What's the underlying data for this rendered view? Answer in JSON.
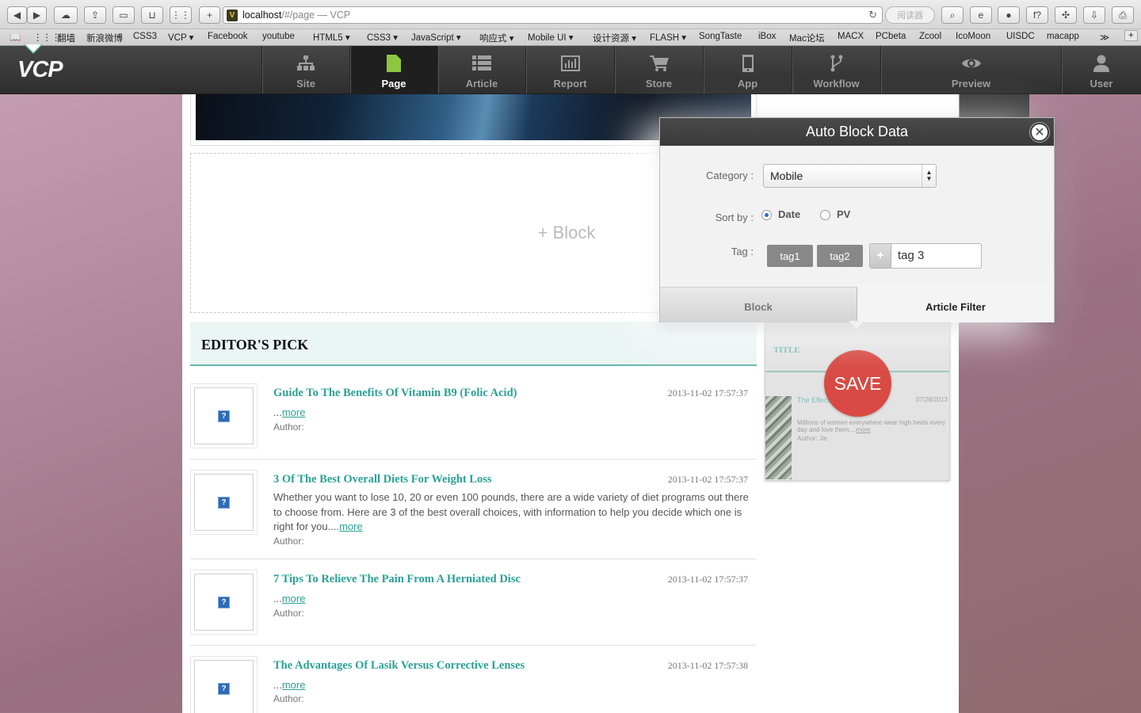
{
  "browser": {
    "url_host": "localhost",
    "url_rest": "/#/page — VCP",
    "reader_label": "阅读器"
  },
  "bookmarks": [
    "翻墙",
    "新浪微博",
    "CSS3",
    "VCP ▾",
    "Facebook",
    "youtube",
    "HTML5 ▾",
    "CSS3 ▾",
    "JavaScript ▾",
    "响应式 ▾",
    "Mobile UI ▾",
    "设计资源 ▾",
    "FLASH ▾",
    "SongTaste",
    "iBox",
    "Mac论坛",
    "MACX",
    "PCbeta",
    "Zcool",
    "IcoMoon",
    "UISDC",
    "macapp"
  ],
  "app": {
    "logo": "VCP",
    "nav": [
      {
        "label": "Site",
        "icon": "sitemap-icon"
      },
      {
        "label": "Page",
        "icon": "page-icon",
        "active": true
      },
      {
        "label": "Article",
        "icon": "list-icon"
      },
      {
        "label": "Report",
        "icon": "chart-icon"
      },
      {
        "label": "Store",
        "icon": "cart-icon"
      },
      {
        "label": "App",
        "icon": "phone-icon"
      },
      {
        "label": "Workflow",
        "icon": "branch-icon"
      },
      {
        "label": "Preview",
        "icon": "eye-icon"
      },
      {
        "label": "User",
        "icon": "user-icon"
      }
    ],
    "accent_color": "#8cc63f"
  },
  "page": {
    "add_block_label": "+ Block",
    "section_title": "EDITOR'S PICK",
    "articles": [
      {
        "title": "Guide To The Benefits Of Vitamin B9 (Folic Acid)",
        "date": "2013-11-02 17:57:37",
        "excerpt": "...",
        "more": "more",
        "author": "Author:"
      },
      {
        "title": "3 Of The Best Overall Diets For Weight Loss",
        "date": "2013-11-02 17:57:37",
        "excerpt": "Whether you want to lose 10, 20 or even 100 pounds, there are a wide variety of diet programs out there to choose from. Here are 3 of the best overall choices, with information to help you decide which one is right for you....",
        "more": "more",
        "author": "Author:"
      },
      {
        "title": "7 Tips To Relieve The Pain From A Herniated Disc",
        "date": "2013-11-02 17:57:37",
        "excerpt": "...",
        "more": "more",
        "author": "Author:"
      },
      {
        "title": "The Advantages Of Lasik Versus Corrective Lenses",
        "date": "2013-11-02 17:57:38",
        "excerpt": "...",
        "more": "more",
        "author": "Author:"
      }
    ],
    "link_color": "#2aa197"
  },
  "preview_card": {
    "title": "TITLE",
    "article_title": "The Effects Of W",
    "date": "07/28/2013",
    "text": "Millions of women everywhere wear high heels every day and love them....",
    "text_more": "more",
    "author": "Author: Jie",
    "save_label": "SAVE",
    "save_color": "#d84a43"
  },
  "modal": {
    "title": "Auto Block Data",
    "close_icon": "close-icon",
    "category_label": "Category :",
    "category_value": "Mobile",
    "sort_label": "Sort by :",
    "sort_options": [
      "Date",
      "PV"
    ],
    "sort_selected": "Date",
    "tag_label": "Tag :",
    "tags": [
      "tag1",
      "tag2"
    ],
    "tag_input_value": "tag 3",
    "tabs": [
      "Block",
      "Article Filter"
    ],
    "active_tab": "Article Filter"
  }
}
